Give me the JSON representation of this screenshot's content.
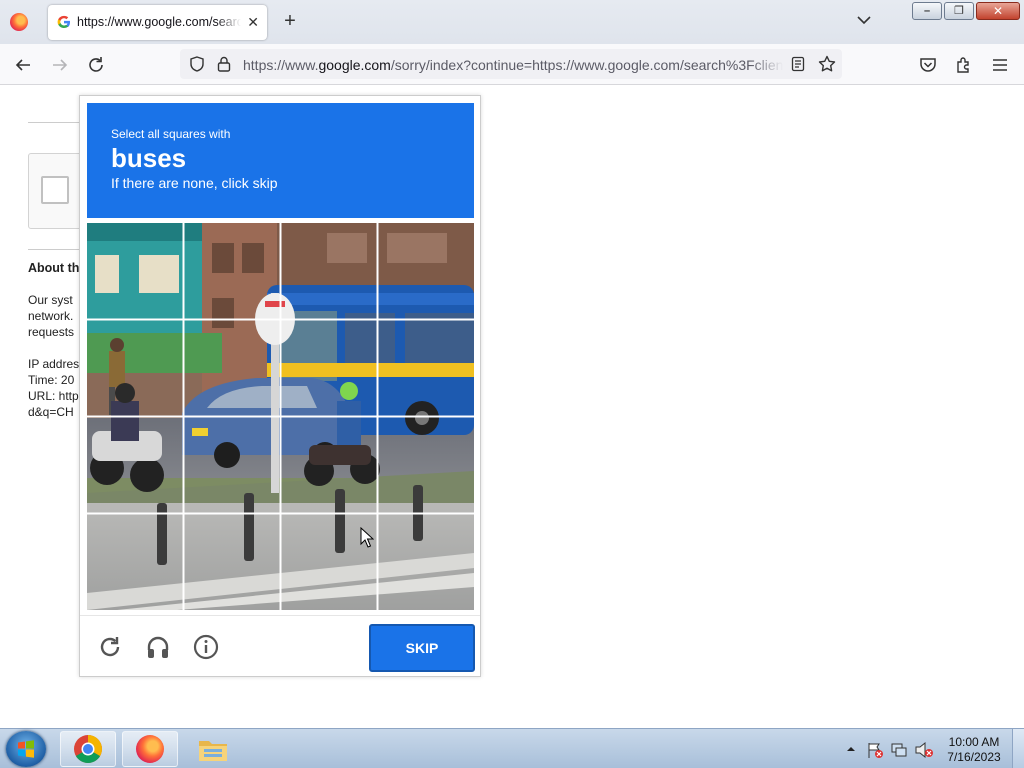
{
  "browser": {
    "tab_title": "https://www.google.com/search",
    "new_tab_label": "+",
    "url_prefix": "https://www.",
    "url_domain": "google.com",
    "url_rest": "/sorry/index?continue=https://www.google.com/search%3Fclient",
    "window_buttons": {
      "minimize": "–",
      "restore": "❐",
      "close": "✕"
    }
  },
  "background_page": {
    "about_heading": "About th",
    "lines": [
      "Our syst",
      "network.",
      "requests",
      "",
      "IP addres",
      "Time: 20",
      "URL: http",
      "d&q=CH"
    ]
  },
  "captcha": {
    "instruction_small": "Select all squares with",
    "target_object": "buses",
    "instruction_sub": "If there are none, click skip",
    "grid_size": 4,
    "skip_label": "SKIP",
    "footer_icons": [
      "reload-icon",
      "audio-challenge-icon",
      "info-icon"
    ]
  },
  "taskbar": {
    "pinned": [
      "chrome-icon",
      "firefox-icon",
      "explorer-folder-icon"
    ],
    "clock_time": "10:00 AM",
    "clock_date": "7/16/2023"
  },
  "colors": {
    "captcha_blue": "#1a73e8",
    "bus_blue": "#1d5ab0"
  }
}
